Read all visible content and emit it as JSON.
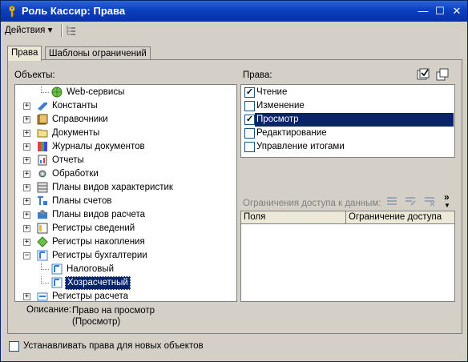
{
  "window": {
    "title": "Роль Кассир: Права",
    "minimize_glyph": "—",
    "maximize_glyph": "☐",
    "close_glyph": "✕"
  },
  "toolbar": {
    "actions_label": "Действия ▾"
  },
  "tabs": [
    {
      "label": "Права",
      "active": true
    },
    {
      "label": "Шаблоны ограничений",
      "active": false
    }
  ],
  "objects": {
    "label": "Объекты:",
    "tree": [
      {
        "label": "Web-сервисы",
        "level": 2,
        "expander": "",
        "icon": "web-service-icon",
        "selected": false
      },
      {
        "label": "Константы",
        "level": 1,
        "expander": "+",
        "icon": "constants-icon",
        "selected": false
      },
      {
        "label": "Справочники",
        "level": 1,
        "expander": "+",
        "icon": "catalogs-icon",
        "selected": false
      },
      {
        "label": "Документы",
        "level": 1,
        "expander": "+",
        "icon": "documents-icon",
        "selected": false
      },
      {
        "label": "Журналы документов",
        "level": 1,
        "expander": "+",
        "icon": "journals-icon",
        "selected": false
      },
      {
        "label": "Отчеты",
        "level": 1,
        "expander": "+",
        "icon": "reports-icon",
        "selected": false
      },
      {
        "label": "Обработки",
        "level": 1,
        "expander": "+",
        "icon": "dataprocessors-icon",
        "selected": false
      },
      {
        "label": "Планы видов характеристик",
        "level": 1,
        "expander": "+",
        "icon": "chart-of-characteristics-icon",
        "selected": false
      },
      {
        "label": "Планы счетов",
        "level": 1,
        "expander": "+",
        "icon": "chart-of-accounts-icon",
        "selected": false
      },
      {
        "label": "Планы видов расчета",
        "level": 1,
        "expander": "+",
        "icon": "chart-of-calculation-icon",
        "selected": false
      },
      {
        "label": "Регистры сведений",
        "level": 1,
        "expander": "+",
        "icon": "information-registers-icon",
        "selected": false
      },
      {
        "label": "Регистры накопления",
        "level": 1,
        "expander": "+",
        "icon": "accumulation-registers-icon",
        "selected": false
      },
      {
        "label": "Регистры бухгалтерии",
        "level": 1,
        "expander": "−",
        "icon": "accounting-registers-icon",
        "selected": false
      },
      {
        "label": "Налоговый",
        "level": 2,
        "expander": "",
        "icon": "accounting-register-icon",
        "selected": false
      },
      {
        "label": "Хозрасчетный",
        "level": 2,
        "expander": "",
        "icon": "accounting-register-icon",
        "selected": true
      },
      {
        "label": "Регистры расчета",
        "level": 1,
        "expander": "+",
        "icon": "calculation-registers-icon",
        "selected": false
      }
    ]
  },
  "rights": {
    "label": "Права:",
    "items": [
      {
        "label": "Чтение",
        "checked": true,
        "selected": false
      },
      {
        "label": "Изменение",
        "checked": false,
        "selected": false
      },
      {
        "label": "Просмотр",
        "checked": true,
        "selected": true
      },
      {
        "label": "Редактирование",
        "checked": false,
        "selected": false
      },
      {
        "label": "Управление итогами",
        "checked": false,
        "selected": false
      }
    ]
  },
  "access": {
    "label": "Ограничения доступа к данным:",
    "columns": [
      "Поля",
      "Ограничение доступа"
    ],
    "more_glyph": "»"
  },
  "description": {
    "label": "Описание:",
    "value": "Право на просмотр\n(Просмотр)"
  },
  "footer": {
    "new_objects_label": "Устанавливать права для новых объектов",
    "new_objects_checked": false
  },
  "colors": {
    "title_bar": "#0a3fbf",
    "selection": "#0a246a",
    "window_bg": "#d4d0c8"
  }
}
